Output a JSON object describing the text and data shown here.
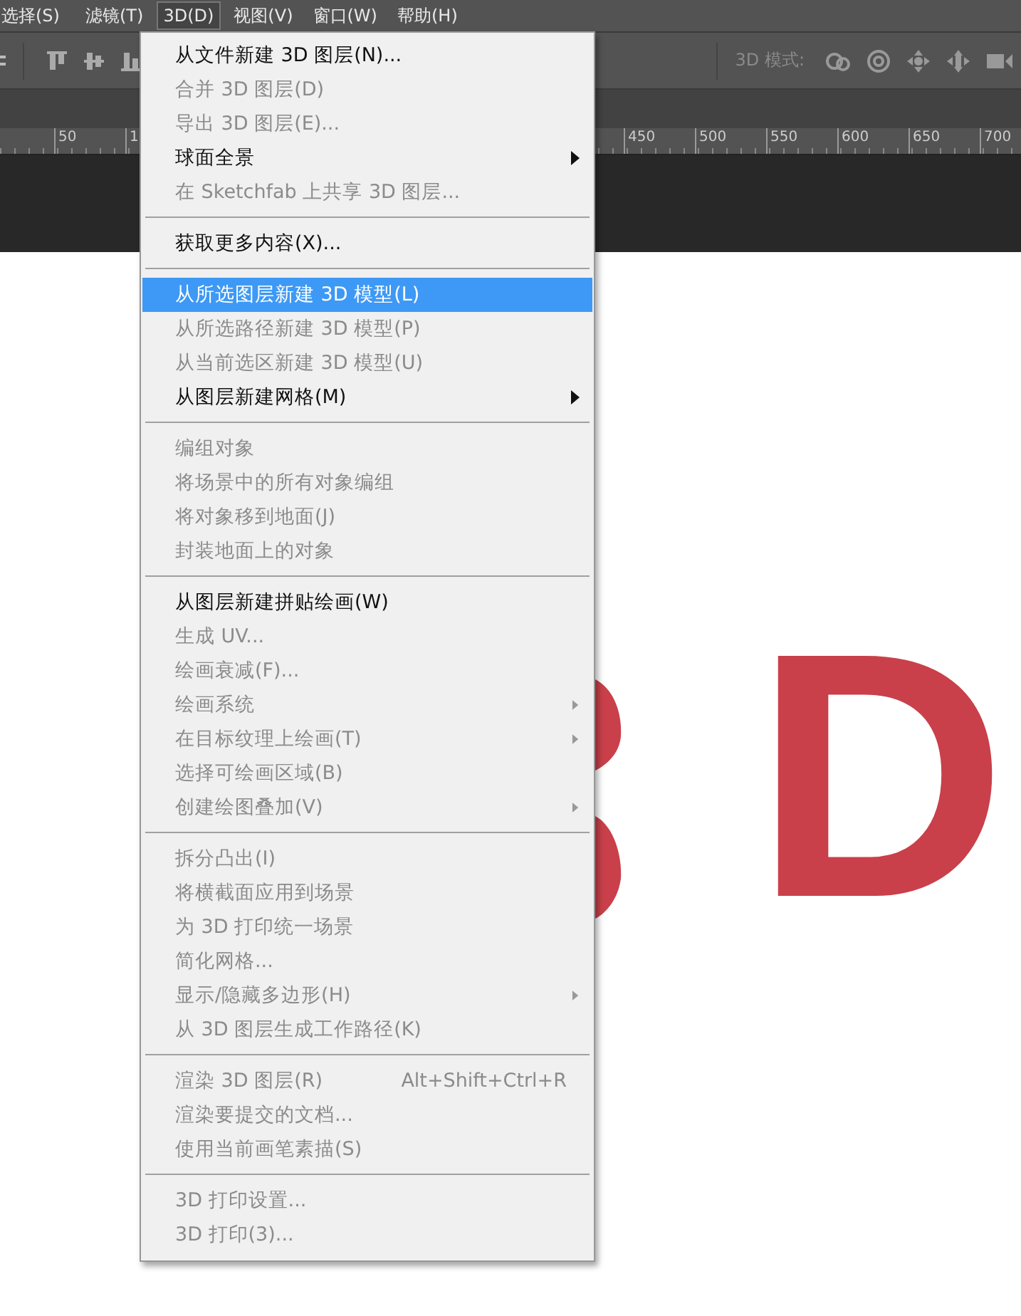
{
  "menubar": [
    {
      "label": "选择(S)",
      "selected": false
    },
    {
      "label": "滤镜(T)",
      "selected": false
    },
    {
      "label": "3D(D)",
      "selected": true
    },
    {
      "label": "视图(V)",
      "selected": false
    },
    {
      "label": "窗口(W)",
      "selected": false
    },
    {
      "label": "帮助(H)",
      "selected": false
    }
  ],
  "toolbar": {
    "mode_label": "3D 模式:"
  },
  "ruler": {
    "left_labels": [
      "50",
      "1"
    ],
    "right_labels": [
      "450",
      "500",
      "550",
      "600",
      "650",
      "700"
    ]
  },
  "canvas": {
    "text": "D"
  },
  "menu": [
    {
      "kind": "item",
      "label": "从文件新建 3D 图层(N)...",
      "disabled": false,
      "selected": false
    },
    {
      "kind": "item",
      "label": "合并 3D 图层(D)",
      "disabled": true,
      "selected": false
    },
    {
      "kind": "item",
      "label": "导出 3D 图层(E)...",
      "disabled": true,
      "selected": false
    },
    {
      "kind": "item",
      "label": "球面全景",
      "disabled": false,
      "selected": false,
      "submenu": true
    },
    {
      "kind": "item",
      "label": "在 Sketchfab 上共享 3D 图层...",
      "disabled": true,
      "selected": false
    },
    {
      "kind": "separator"
    },
    {
      "kind": "item",
      "label": "获取更多内容(X)...",
      "disabled": false,
      "selected": false
    },
    {
      "kind": "separator"
    },
    {
      "kind": "item",
      "label": "从所选图层新建 3D 模型(L)",
      "disabled": false,
      "selected": true
    },
    {
      "kind": "item",
      "label": "从所选路径新建 3D 模型(P)",
      "disabled": true,
      "selected": false
    },
    {
      "kind": "item",
      "label": "从当前选区新建 3D 模型(U)",
      "disabled": true,
      "selected": false
    },
    {
      "kind": "item",
      "label": "从图层新建网格(M)",
      "disabled": false,
      "selected": false,
      "submenu": true
    },
    {
      "kind": "separator"
    },
    {
      "kind": "item",
      "label": "编组对象",
      "disabled": true,
      "selected": false
    },
    {
      "kind": "item",
      "label": "将场景中的所有对象编组",
      "disabled": true,
      "selected": false
    },
    {
      "kind": "item",
      "label": "将对象移到地面(J)",
      "disabled": true,
      "selected": false
    },
    {
      "kind": "item",
      "label": "封装地面上的对象",
      "disabled": true,
      "selected": false
    },
    {
      "kind": "separator"
    },
    {
      "kind": "item",
      "label": "从图层新建拼贴绘画(W)",
      "disabled": false,
      "selected": false
    },
    {
      "kind": "item",
      "label": "生成 UV...",
      "disabled": true,
      "selected": false
    },
    {
      "kind": "item",
      "label": "绘画衰减(F)...",
      "disabled": true,
      "selected": false
    },
    {
      "kind": "item",
      "label": "绘画系统",
      "disabled": true,
      "selected": false,
      "submenu": true
    },
    {
      "kind": "item",
      "label": "在目标纹理上绘画(T)",
      "disabled": true,
      "selected": false,
      "submenu": true
    },
    {
      "kind": "item",
      "label": "选择可绘画区域(B)",
      "disabled": true,
      "selected": false
    },
    {
      "kind": "item",
      "label": "创建绘图叠加(V)",
      "disabled": true,
      "selected": false,
      "submenu": true
    },
    {
      "kind": "separator"
    },
    {
      "kind": "item",
      "label": "拆分凸出(I)",
      "disabled": true,
      "selected": false
    },
    {
      "kind": "item",
      "label": "将横截面应用到场景",
      "disabled": true,
      "selected": false
    },
    {
      "kind": "item",
      "label": "为 3D 打印统一场景",
      "disabled": true,
      "selected": false
    },
    {
      "kind": "item",
      "label": "简化网格...",
      "disabled": true,
      "selected": false
    },
    {
      "kind": "item",
      "label": "显示/隐藏多边形(H)",
      "disabled": true,
      "selected": false,
      "submenu": true
    },
    {
      "kind": "item",
      "label": "从 3D 图层生成工作路径(K)",
      "disabled": true,
      "selected": false
    },
    {
      "kind": "separator"
    },
    {
      "kind": "item",
      "label": "渲染 3D 图层(R)",
      "disabled": true,
      "selected": false,
      "shortcut": "Alt+Shift+Ctrl+R"
    },
    {
      "kind": "item",
      "label": "渲染要提交的文档...",
      "disabled": true,
      "selected": false
    },
    {
      "kind": "item",
      "label": "使用当前画笔素描(S)",
      "disabled": true,
      "selected": false
    },
    {
      "kind": "separator"
    },
    {
      "kind": "item",
      "label": "3D 打印设置...",
      "disabled": true,
      "selected": false
    },
    {
      "kind": "item",
      "label": "3D 打印(3)...",
      "disabled": true,
      "selected": false
    }
  ]
}
